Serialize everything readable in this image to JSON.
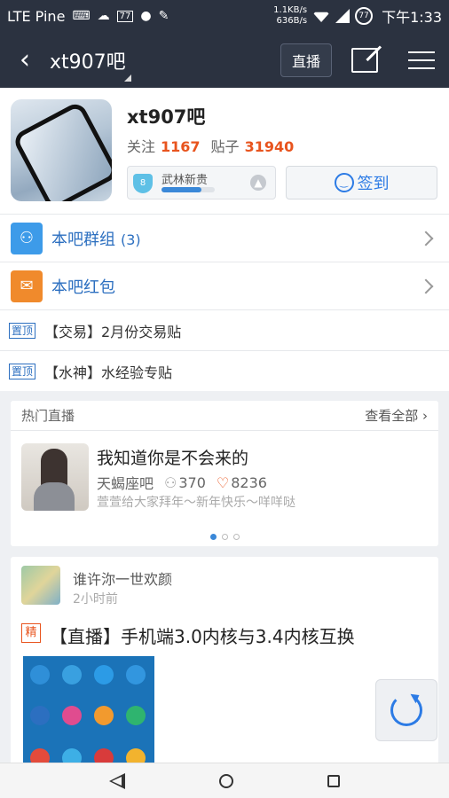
{
  "status_bar": {
    "carrier": "LTE Pine",
    "speed_up": "1.1KB/s",
    "speed_down": "636B/s",
    "battery_badge": "77",
    "notif_badge": "77",
    "time": "下午1:33"
  },
  "app_bar": {
    "back_icon": "back-chevron",
    "title": "xt907吧",
    "live_button": "直播",
    "edit_icon": "edit-icon",
    "menu_icon": "menu-icon"
  },
  "forum": {
    "name": "xt907吧",
    "follow_label": "关注",
    "follow_count": "1167",
    "posts_label": "贴子",
    "posts_count": "31940",
    "level_number": "8",
    "level_name": "武林新贵",
    "level_progress": 0.75,
    "sign_in_label": "签到"
  },
  "rows": {
    "group_label": "本吧群组",
    "group_count": "(3)",
    "red_packet_label": "本吧红包",
    "pinned": [
      {
        "tag": "置顶",
        "text": "【交易】2月份交易贴"
      },
      {
        "tag": "置顶",
        "text": "【水神】水经验专贴"
      }
    ]
  },
  "live_section": {
    "heading": "热门直播",
    "see_all": "查看全部",
    "item": {
      "title": "我知道你是不会来的",
      "forum": "天蝎座吧",
      "viewers": "370",
      "likes": "8236",
      "desc": "萱萱给大家拜年～新年快乐～咩咩哒"
    },
    "page_dots": 3,
    "active_dot": 0
  },
  "post": {
    "user": "谁许沵一世欢颜",
    "time": "2小时前",
    "tag": "精",
    "title": "【直播】手机端3.0内核与3.4内核互换"
  },
  "colors": {
    "top_bar": "#2b3240",
    "accent_blue": "#2c7be5",
    "accent_orange": "#e8541e"
  }
}
